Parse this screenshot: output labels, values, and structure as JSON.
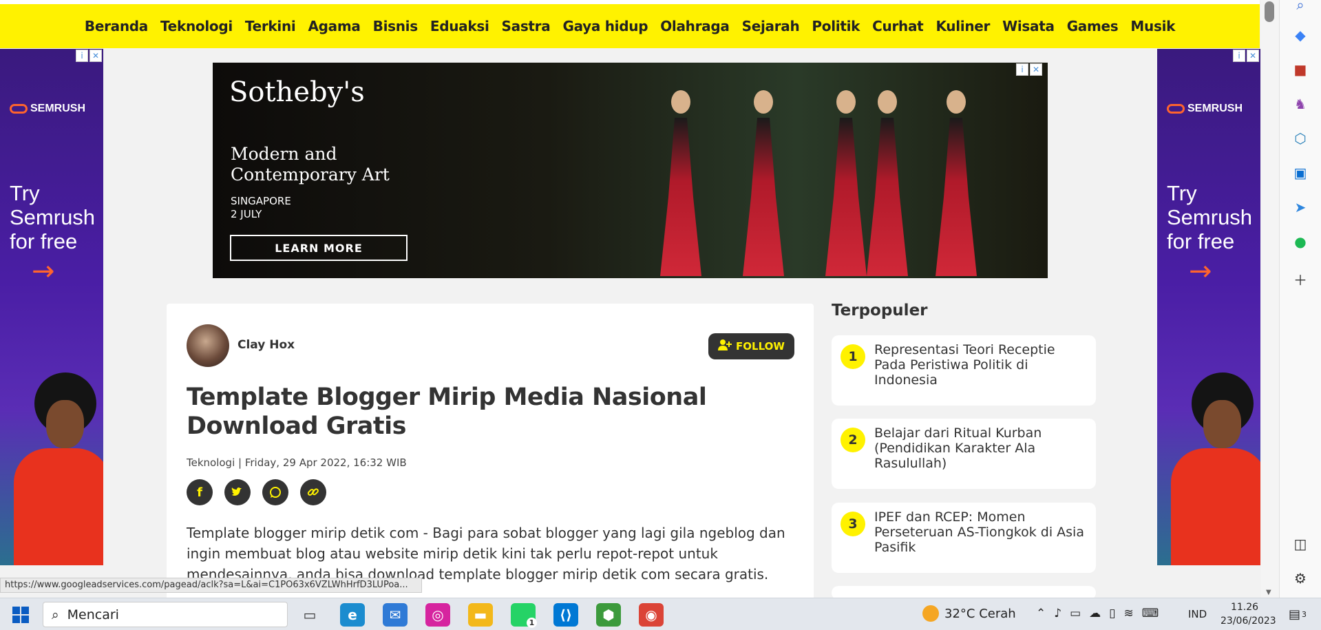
{
  "nav": {
    "items": [
      "Beranda",
      "Teknologi",
      "Terkini",
      "Agama",
      "Bisnis",
      "Eduaksi",
      "Sastra",
      "Gaya hidup",
      "Olahraga",
      "Sejarah",
      "Politik",
      "Curhat",
      "Kuliner",
      "Wisata",
      "Games",
      "Musik"
    ]
  },
  "side_ad": {
    "brand": "SEMRUSH",
    "headline": "Try Semrush for free",
    "arrow": "→"
  },
  "banner_ad": {
    "brand": "Sotheby's",
    "subtitle": "Modern and Contemporary Art",
    "location": "SINGAPORE",
    "date": "2 JULY",
    "cta": "LEARN MORE"
  },
  "ad_controls": {
    "info": "i",
    "close": "✕"
  },
  "article": {
    "author": "Clay Hox",
    "follow_label": "FOLLOW",
    "title": "Template Blogger Mirip Media Nasional Download Gratis",
    "meta": "Teknologi | Friday, 29 Apr 2022, 16:32 WIB",
    "body": "Template blogger mirip detik com - Bagi para sobat blogger yang lagi gila ngeblog dan ingin membuat blog atau website mirip detik kini tak perlu repot-repot untuk mendesainnya, anda bisa download template blogger mirip detik com secara gratis.",
    "share_icons": [
      "facebook-icon",
      "twitter-icon",
      "whatsapp-icon",
      "link-icon"
    ]
  },
  "sidebar": {
    "heading": "Terpopuler",
    "items": [
      {
        "num": "1",
        "title": "Representasi Teori Receptie Pada Peristiwa Politik di Indonesia"
      },
      {
        "num": "2",
        "title": "Belajar dari Ritual Kurban (Pendidikan Karakter Ala Rasulullah)"
      },
      {
        "num": "3",
        "title": "IPEF dan RCEP: Momen Perseteruan AS-Tiongkok di Asia Pasifik"
      }
    ]
  },
  "status_url": "https://www.googleadservices.com/pagead/aclk?sa=L&ai=C1PO63x6VZLWhHrfD3LUPoa...",
  "taskbar": {
    "search_placeholder": "Mencari",
    "weather": "32°C  Cerah",
    "lang": "IND",
    "time": "11.26",
    "date": "23/06/2023",
    "whatsapp_badge": "1",
    "notif_badge": "3"
  },
  "colors": {
    "accent_yellow": "#fff200",
    "dark": "#333333",
    "semrush_orange": "#ff642d"
  }
}
